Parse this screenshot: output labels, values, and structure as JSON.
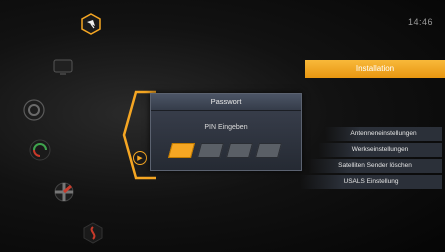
{
  "clock": "14:46",
  "sidebar": {
    "icons": [
      {
        "name": "satellite-icon"
      },
      {
        "name": "tv-icon"
      },
      {
        "name": "settings-gear-icon"
      },
      {
        "name": "search-icon"
      },
      {
        "name": "tools-icon"
      },
      {
        "name": "signal-icon"
      }
    ]
  },
  "dialog": {
    "title": "Passwort",
    "prompt": "PIN Eingeben",
    "pin_boxes": 4,
    "active_box": 1
  },
  "menu": {
    "header": "Installation",
    "items": [
      {
        "label": "Antenneneinstellungen"
      },
      {
        "label": "Werkseinstellungen"
      },
      {
        "label": "Satelliten Sender löschen"
      },
      {
        "label": "USALS Einstellung"
      }
    ]
  },
  "colors": {
    "accent": "#f5a623",
    "dialog_bg": "#2e333d"
  }
}
